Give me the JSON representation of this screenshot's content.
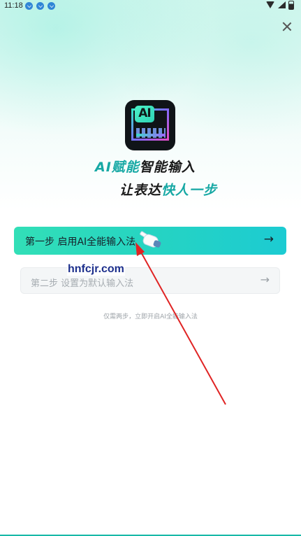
{
  "status_bar": {
    "time": "11:18"
  },
  "logo": {
    "text": "AI"
  },
  "headline": {
    "line1_accent": "AI赋能",
    "line1_rest": "智能输入",
    "line2_rest": "让表达",
    "line2_accent": "快人一步"
  },
  "steps": {
    "step1_label": "第一步  启用AI全能输入法",
    "step2_label": "第二步  设置为默认输入法",
    "arrow": "→"
  },
  "hint": "仅需两步，立即开启AI全能输入法",
  "watermark": "hnfcjr.com",
  "colors": {
    "accent": "#16a8a4",
    "primary_button_start": "#32dfb7",
    "primary_button_end": "#1ccbd2",
    "annotation_arrow": "#e02424"
  }
}
